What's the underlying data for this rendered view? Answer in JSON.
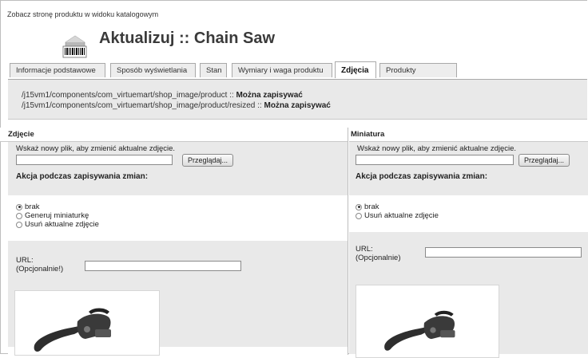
{
  "header": {
    "top_link": "Zobacz stronę produktu w widoku katalogowym",
    "logo_icon": "product-barcode-icon",
    "title": "Aktualizuj :: Chain Saw"
  },
  "tabs": [
    {
      "label": "Informacje podstawowe",
      "active": false
    },
    {
      "label": "Sposób wyświetlania",
      "active": false
    },
    {
      "label": "Stan",
      "active": false
    },
    {
      "label": "Wymiary i waga produktu",
      "active": false
    },
    {
      "label": "Zdjęcia",
      "active": true
    },
    {
      "label": "Produkty pokrewne",
      "active": false
    }
  ],
  "paths": {
    "line1_path": "/j15vm1/components/com_virtuemart/shop_image/product :: ",
    "line1_status": "Można zapisywać",
    "line2_path": "/j15vm1/components/com_virtuemart/shop_image/product/resized :: ",
    "line2_status": "Można zapisywać"
  },
  "left": {
    "heading": "Zdjęcie",
    "hint": "Wskaż nowy plik, aby zmienić aktualne zdjęcie.",
    "browse": "Przeglądaj...",
    "action_title": "Akcja podczas zapisywania zmian:",
    "options": [
      "brak",
      "Generuj miniaturkę",
      "Usuń aktualne zdjęcie"
    ],
    "selected_option": "brak",
    "url_label": "URL:",
    "url_sub": "(Opcjonalnie!)",
    "url_value": "",
    "image_icon": "chainsaw-image"
  },
  "right": {
    "heading": "Miniatura",
    "hint": "Wskaż nowy plik, aby zmienić aktualne zdjęcie.",
    "browse": "Przeglądaj...",
    "action_title": "Akcja podczas zapisywania zmian:",
    "options": [
      "brak",
      "Usuń aktualne zdjęcie"
    ],
    "selected_option": "brak",
    "url_label": "URL:",
    "url_sub": "(Opcjonalnie)",
    "url_value": "",
    "image_icon": "chainsaw-thumbnail-image"
  }
}
